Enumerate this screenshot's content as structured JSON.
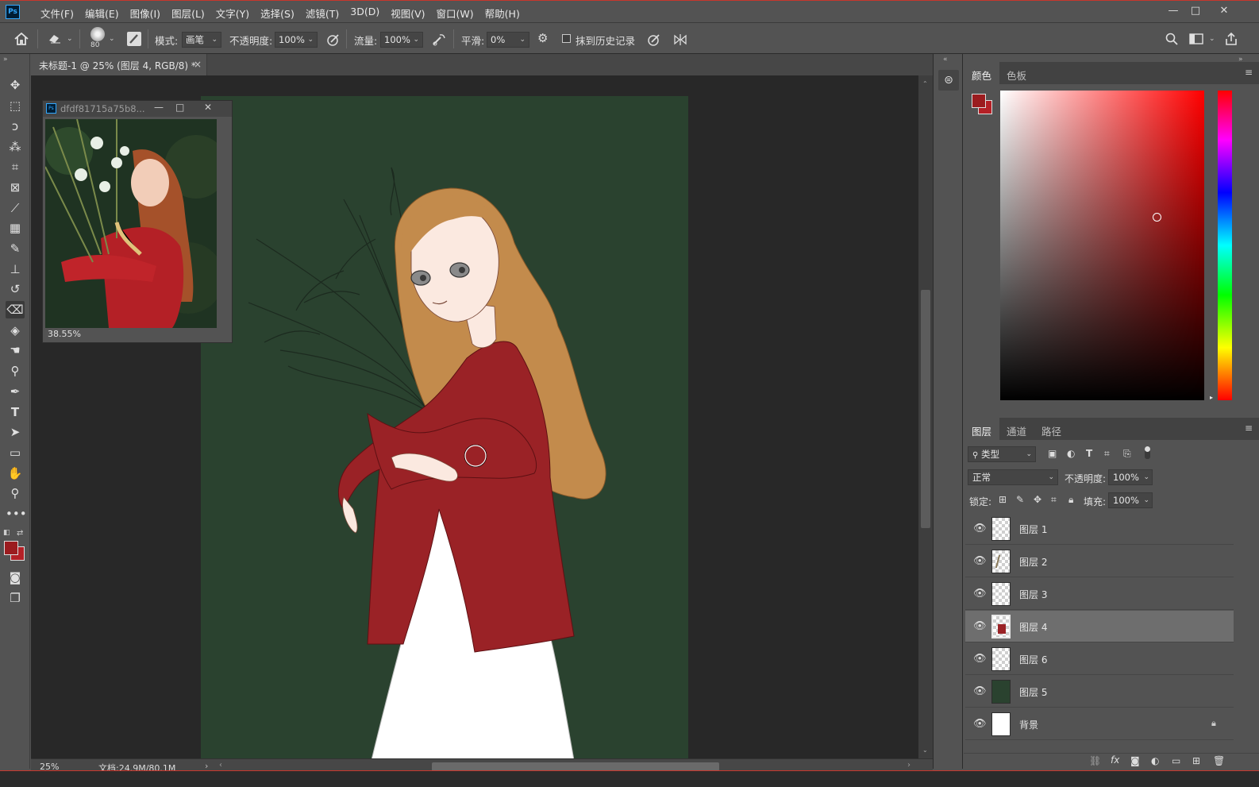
{
  "app": {
    "logo": "Ps"
  },
  "menu": [
    "文件(F)",
    "编辑(E)",
    "图像(I)",
    "图层(L)",
    "文字(Y)",
    "选择(S)",
    "滤镜(T)",
    "3D(D)",
    "视图(V)",
    "窗口(W)",
    "帮助(H)"
  ],
  "options": {
    "brush_size": "80",
    "mode_label": "模式:",
    "mode_value": "画笔",
    "opacity_label": "不透明度:",
    "opacity_value": "100%",
    "flow_label": "流量:",
    "flow_value": "100%",
    "smooth_label": "平滑:",
    "smooth_value": "0%",
    "erase_history_label": "抹到历史记录"
  },
  "document": {
    "tab_title": "未标题-1 @ 25% (图层 4, RGB/8) *",
    "tab_close": "×",
    "zoom": "25%",
    "doc_info": "文档:24.9M/80.1M"
  },
  "navigator": {
    "title": "dfdf81715a75b8...",
    "zoom": "38.55%"
  },
  "color_panel": {
    "tabs": [
      "颜色",
      "色板"
    ],
    "foreground": "#9b1c1f",
    "background": "#b42026",
    "hue": "#ff0000"
  },
  "layers_panel": {
    "tabs": [
      "图层",
      "通道",
      "路径"
    ],
    "filter_label": "类型",
    "blend_mode": "正常",
    "opacity_label": "不透明度:",
    "opacity_value": "100%",
    "lock_label": "锁定:",
    "fill_label": "填充:",
    "fill_value": "100%",
    "layers": [
      {
        "name": "图层 1",
        "thumb": "transparent"
      },
      {
        "name": "图层 2",
        "thumb": "sketch"
      },
      {
        "name": "图层 3",
        "thumb": "transparent"
      },
      {
        "name": "图层 4",
        "thumb": "red-figure",
        "selected": true
      },
      {
        "name": "图层 6",
        "thumb": "transparent"
      },
      {
        "name": "图层 5",
        "thumb": "green"
      },
      {
        "name": "背景",
        "thumb": "white",
        "locked": true
      }
    ]
  },
  "colors": {
    "canvas_bg": "#2a422f",
    "jacket": "#9a2226",
    "hair": "#c38b4c",
    "dress": "#ffffff",
    "skin": "#fbe9e0"
  }
}
